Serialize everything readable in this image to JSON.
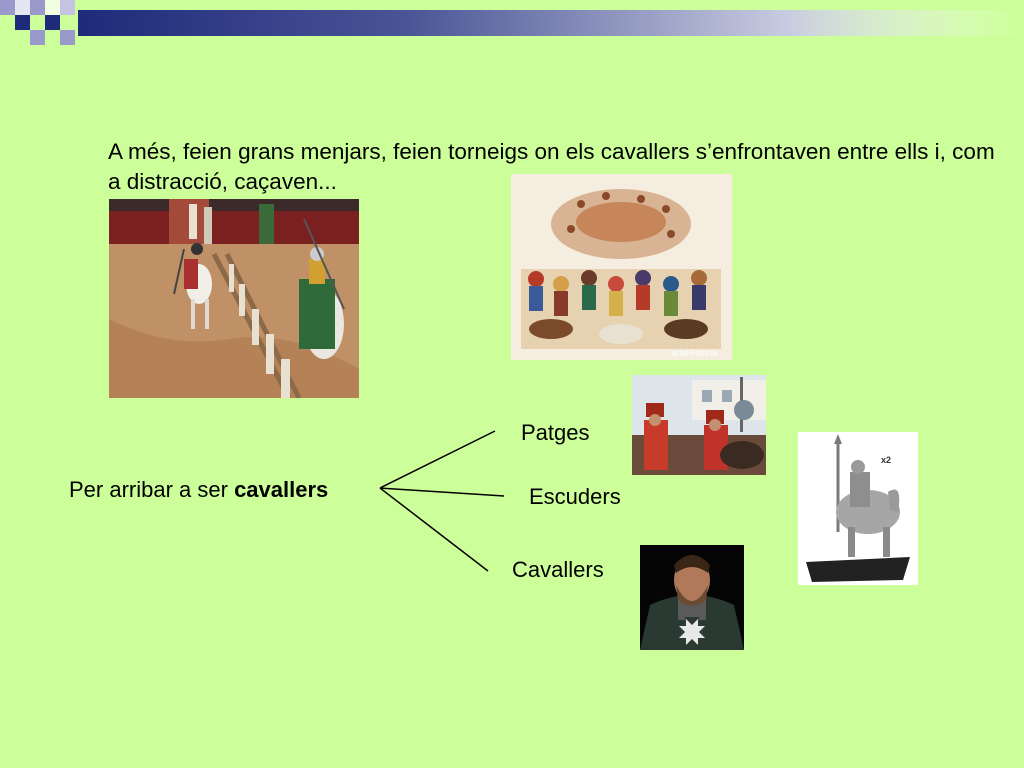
{
  "slide": {
    "intro_text": "A més, feien grans menjars, feien torneigs on els cavallers s’enfrontaven entre ells i, com a distracció, caçaven...",
    "diagram": {
      "prefix": "Per arribar a ser ",
      "prefix_bold": "cavallers",
      "branches": [
        "Patges",
        "Escuders",
        "Cavallers"
      ]
    },
    "images": {
      "banquet_watermark": "arteHistoria",
      "figurine_badge": "x2"
    }
  },
  "colors": {
    "background": "#ccff99",
    "header_navy": "#1f2a7a",
    "header_lavender": "#9999cc"
  }
}
